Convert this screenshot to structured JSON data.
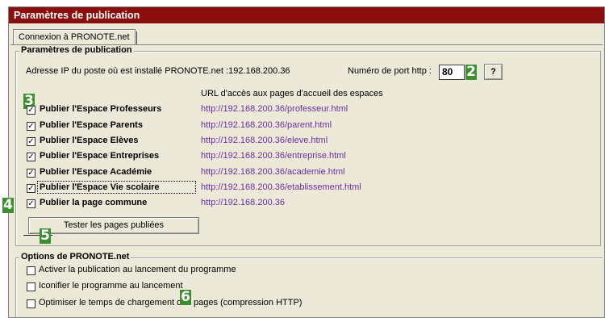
{
  "window": {
    "title": "Paramètres de publication"
  },
  "tabs": [
    {
      "label": "Connexion à PRONOTE.net"
    }
  ],
  "publication": {
    "group_title": "Paramètres de publication",
    "ip_text": "Adresse IP du poste où est installé PRONOTE.net :192.168.200.36",
    "port_label": "Numéro de port http :",
    "port_value": "80",
    "help_button": "?",
    "urls_header": "URL d'accès aux pages d'accueil des espaces",
    "items": [
      {
        "label": "Publier l'Espace Professeurs",
        "url": "http://192.168.200.36/professeur.html",
        "checked": true
      },
      {
        "label": "Publier l'Espace Parents",
        "url": "http://192.168.200.36/parent.html",
        "checked": true
      },
      {
        "label": "Publier l'Espace Elèves",
        "url": "http://192.168.200.36/eleve.html",
        "checked": true
      },
      {
        "label": "Publier l'Espace Entreprises",
        "url": "http://192.168.200.36/entreprise.html",
        "checked": true
      },
      {
        "label": "Publier l'Espace Académie",
        "url": "http://192.168.200.36/academie.html",
        "checked": true
      },
      {
        "label": "Publier l'Espace  Vie scolaire",
        "url": "http://192.168.200.36/etablissement.html",
        "checked": true
      },
      {
        "label": "Publier la page commune",
        "url": "http://192.168.200.36",
        "checked": true
      }
    ],
    "test_button": "Tester les pages publiées"
  },
  "options": {
    "group_title": "Options de PRONOTE.net",
    "items": [
      {
        "label": "Activer la publication au lancement du programme",
        "checked": false
      },
      {
        "label": "Iconifier le programme au lancement",
        "checked": false
      },
      {
        "label": "Optimiser le temps de chargement des pages (compression HTTP)",
        "checked": false
      }
    ]
  },
  "markers": {
    "m2": "2",
    "m3": "3",
    "m4": "4",
    "m5": "5",
    "m6": "6"
  },
  "colors": {
    "titlebar": "#8b0f0f",
    "link": "#6b2fa0",
    "marker": "#3c8f2f",
    "panel": "#ece9d8"
  }
}
